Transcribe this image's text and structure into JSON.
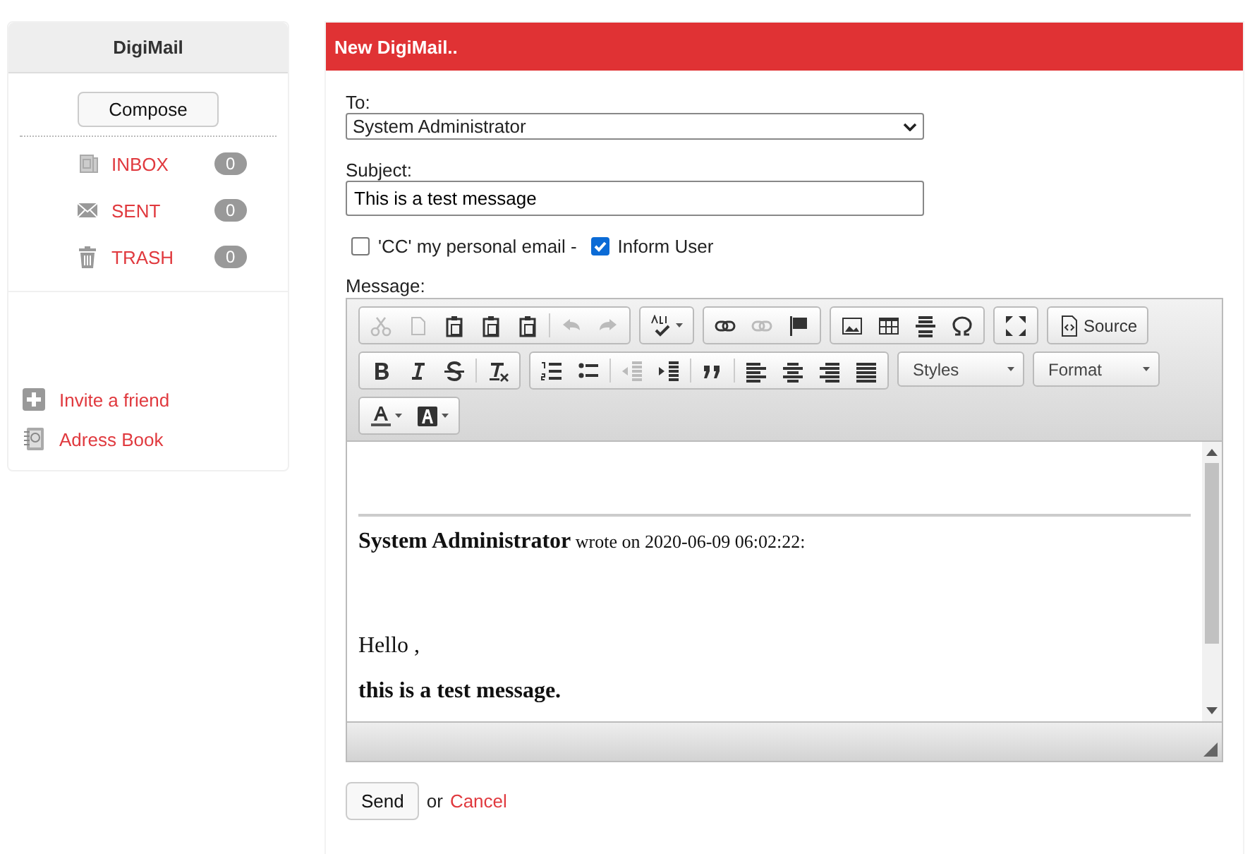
{
  "sidebar": {
    "title": "DigiMail",
    "compose": "Compose",
    "folders": [
      {
        "kind": "inbox",
        "label": "INBOX",
        "count": "0"
      },
      {
        "kind": "sent",
        "label": "SENT",
        "count": "0"
      },
      {
        "kind": "trash",
        "label": "TRASH",
        "count": "0"
      }
    ],
    "links": [
      {
        "kind": "invite",
        "label": "Invite a friend"
      },
      {
        "kind": "addressbook",
        "label": "Adress Book"
      }
    ]
  },
  "panel": {
    "title": "New DigiMail..",
    "to": {
      "label": "To:",
      "value": "System Administrator"
    },
    "subject": {
      "label": "Subject:",
      "value": "This is a test message"
    },
    "options": [
      {
        "label": "'CC' my personal email -",
        "checked": false
      },
      {
        "label": "Inform User",
        "checked": true
      }
    ],
    "message_label": "Message:",
    "toolbar": [
      {
        "groups": [
          {
            "kind": "buttons",
            "items": [
              {
                "kind": "cut",
                "disabled": true
              },
              {
                "kind": "copy",
                "disabled": true
              },
              {
                "kind": "paste",
                "disabled": false
              },
              {
                "kind": "paste_text",
                "disabled": false
              },
              {
                "kind": "paste_word",
                "disabled": false
              },
              {
                "kind": "separator"
              },
              {
                "kind": "undo",
                "disabled": true
              },
              {
                "kind": "redo",
                "disabled": true
              }
            ]
          },
          {
            "kind": "buttons",
            "items": [
              {
                "kind": "spellcheck",
                "disabled": false
              }
            ]
          },
          {
            "kind": "buttons",
            "items": [
              {
                "kind": "link",
                "disabled": false
              },
              {
                "kind": "unlink",
                "disabled": true
              },
              {
                "kind": "anchor",
                "disabled": false
              }
            ]
          },
          {
            "kind": "buttons",
            "items": [
              {
                "kind": "image",
                "disabled": false
              },
              {
                "kind": "table",
                "disabled": false
              },
              {
                "kind": "hline",
                "disabled": false
              },
              {
                "kind": "special_char",
                "disabled": false
              }
            ]
          },
          {
            "kind": "buttons",
            "items": [
              {
                "kind": "maximize",
                "disabled": false
              }
            ]
          },
          {
            "kind": "buttons",
            "items": [
              {
                "kind": "source",
                "label": "Source",
                "disabled": false
              }
            ]
          }
        ]
      },
      {
        "groups": [
          {
            "kind": "buttons",
            "items": [
              {
                "kind": "bold",
                "disabled": false
              },
              {
                "kind": "italic",
                "disabled": false
              },
              {
                "kind": "strike",
                "disabled": false
              },
              {
                "kind": "separator"
              },
              {
                "kind": "remove_format",
                "disabled": false
              }
            ]
          },
          {
            "kind": "buttons",
            "items": [
              {
                "kind": "numbered_list",
                "disabled": false
              },
              {
                "kind": "bulleted_list",
                "disabled": false
              },
              {
                "kind": "separator"
              },
              {
                "kind": "outdent",
                "disabled": true
              },
              {
                "kind": "indent",
                "disabled": false
              },
              {
                "kind": "separator"
              },
              {
                "kind": "blockquote",
                "disabled": false
              },
              {
                "kind": "separator"
              },
              {
                "kind": "align_left",
                "disabled": false
              },
              {
                "kind": "align_center",
                "disabled": false
              },
              {
                "kind": "align_right",
                "disabled": false
              },
              {
                "kind": "justify",
                "disabled": false
              }
            ]
          },
          {
            "kind": "combo",
            "label": "Styles"
          },
          {
            "kind": "combo",
            "label": "Format"
          }
        ]
      },
      {
        "groups": [
          {
            "kind": "buttons",
            "items": [
              {
                "kind": "text_color",
                "disabled": false
              },
              {
                "kind": "bg_color",
                "disabled": false
              }
            ]
          }
        ]
      }
    ],
    "body": [
      {
        "kind": "quote_header",
        "text": "**System Administrator** wrote on 2020-06-09 06:02:22:"
      },
      {
        "kind": "paragraph",
        "text": "Hello ,"
      },
      {
        "kind": "bold_paragraph",
        "text": "this is a test message."
      }
    ],
    "send": "Send",
    "or": "or",
    "cancel": "Cancel"
  }
}
